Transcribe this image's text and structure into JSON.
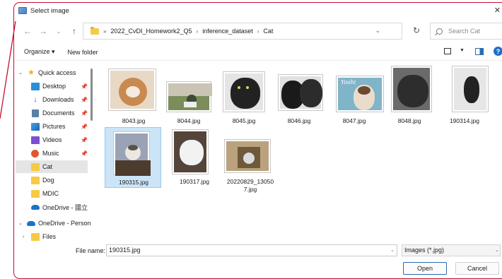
{
  "window": {
    "title": "Select image"
  },
  "navigation": {
    "breadcrumbs": [
      "2022_CvDI_Homework2_Q5",
      "inference_dataset",
      "Cat"
    ],
    "search_placeholder": "Search Cat"
  },
  "toolbar": {
    "organize_label": "Organize ▾",
    "new_folder_label": "New folder"
  },
  "sidebar": {
    "items": [
      {
        "label": "Quick access",
        "icon": "star-icon"
      },
      {
        "label": "Desktop",
        "icon": "desktop-icon"
      },
      {
        "label": "Downloads",
        "icon": "download-icon"
      },
      {
        "label": "Documents",
        "icon": "documents-icon"
      },
      {
        "label": "Pictures",
        "icon": "pictures-icon"
      },
      {
        "label": "Videos",
        "icon": "videos-icon"
      },
      {
        "label": "Music",
        "icon": "music-icon"
      },
      {
        "label": "Cat",
        "icon": "folder-icon",
        "selected": true
      },
      {
        "label": "Dog",
        "icon": "folder-icon"
      },
      {
        "label": "MDIC",
        "icon": "folder-icon"
      },
      {
        "label": "OneDrive - 國立",
        "icon": "cloud-icon"
      },
      {
        "label": "OneDrive - Person",
        "icon": "cloud-icon"
      },
      {
        "label": "Files",
        "icon": "folder-icon"
      }
    ]
  },
  "files": [
    {
      "name": "8043.jpg",
      "colors": [
        "#e8d8c6",
        "#c88a4e"
      ]
    },
    {
      "name": "8044.jpg",
      "colors": [
        "#7c8c5a",
        "#3e4a36"
      ]
    },
    {
      "name": "8045.jpg",
      "colors": [
        "#303030",
        "#1a1a1a"
      ]
    },
    {
      "name": "8046.jpg",
      "colors": [
        "#3a3a3a",
        "#111111"
      ]
    },
    {
      "name": "8047.jpg",
      "colors": [
        "#7fb4c9",
        "#c9a27a"
      ]
    },
    {
      "name": "8048.jpg",
      "colors": [
        "#2d2d2d",
        "#6a6a6a"
      ]
    },
    {
      "name": "190314.jpg",
      "colors": [
        "#e6e6e6",
        "#222222"
      ]
    },
    {
      "name": "190315.jpg",
      "colors": [
        "#9aa3b5",
        "#4b3c2e"
      ],
      "selected": true
    },
    {
      "name": "190317.jpg",
      "colors": [
        "#f2f2f2",
        "#55443a"
      ]
    },
    {
      "name": "20220829_130507.jpg",
      "colors": [
        "#b9a27c",
        "#6e5a3b"
      ]
    }
  ],
  "footer": {
    "file_name_label": "File name:",
    "file_name_value": "190315.jpg",
    "filter_value": "Images (*.jpg)",
    "open_label": "Open",
    "cancel_label": "Cancel"
  }
}
